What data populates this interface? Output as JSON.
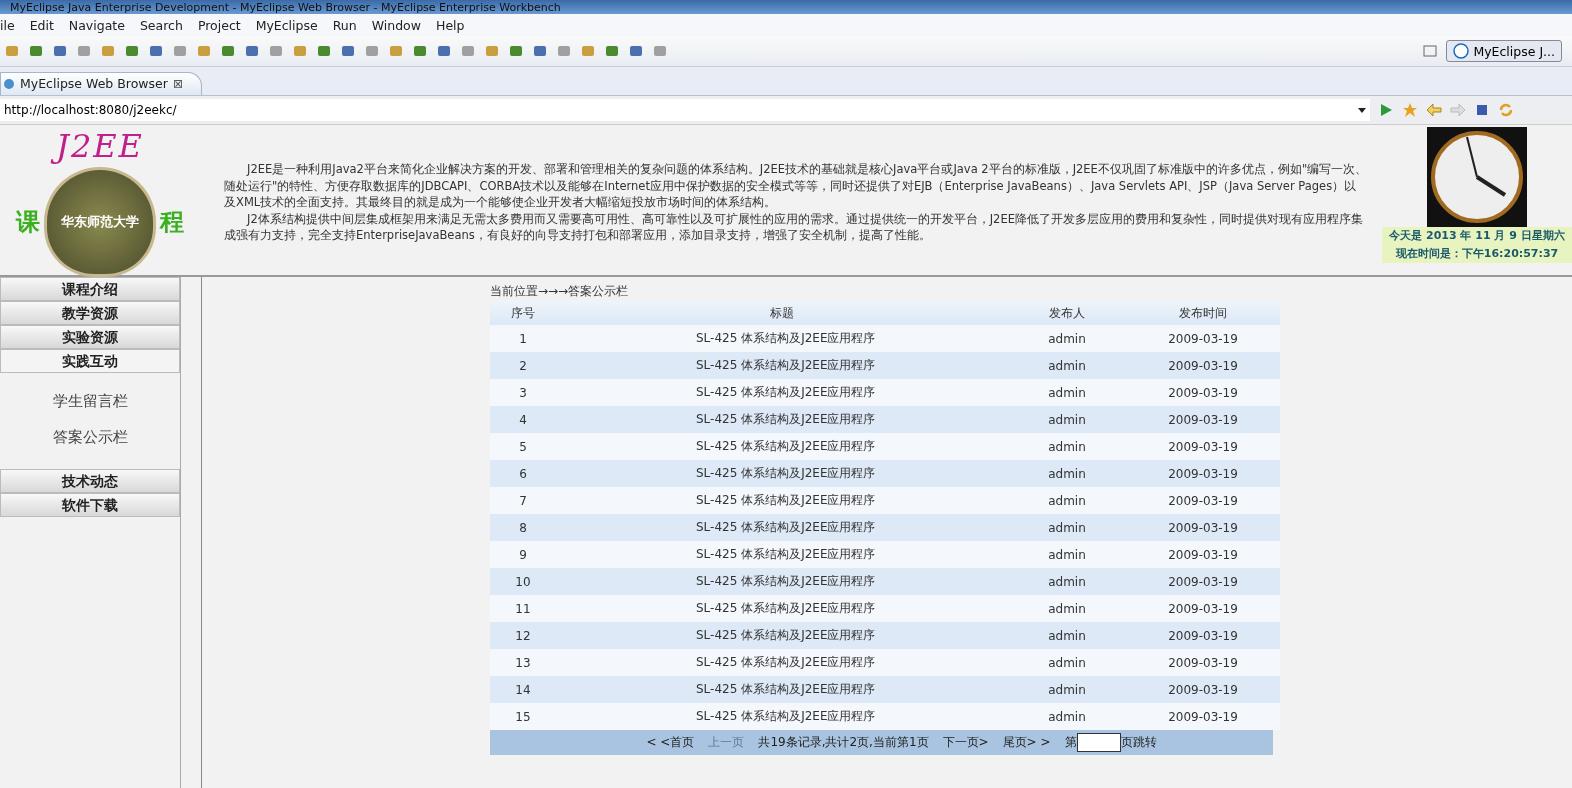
{
  "window": {
    "title": "MyEclipse Java Enterprise Development - MyEclipse Web Browser - MyEclipse Enterprise Workbench"
  },
  "menu": [
    "ile",
    "Edit",
    "Navigate",
    "Search",
    "Project",
    "MyEclipse",
    "Run",
    "Window",
    "Help"
  ],
  "perspective": {
    "label": "MyEclipse J..."
  },
  "editor_tab": {
    "label": "MyEclipse Web Browser",
    "close": "⊠"
  },
  "browser": {
    "url": "http://localhost:8080/j2eekc/"
  },
  "header": {
    "logo_title": "J2EE",
    "logo_left": "课",
    "logo_right": "程",
    "emblem_text": "华东师范大学",
    "paragraphs": [
      "J2EE是一种利用Java2平台来简化企业解决方案的开发、部署和管理相关的复杂问题的体系结构。J2EE技术的基础就是核心Java平台或Java 2平台的标准版，J2EE不仅巩固了标准版中的许多优点，例如\"编写一次、随处运行\"的特性、方便存取数据库的JDBCAPI、CORBA技术以及能够在Internet应用中保护数据的安全模式等等，同时还提供了对EJB（Enterprise JavaBeans）、Java Servlets API、JSP（Java Server Pages）以及XML技术的全面支持。其最终目的就是成为一个能够使企业开发者大幅缩短投放市场时间的体系结构。",
      "J2体系结构提供中间层集成框架用来满足无需太多费用而又需要高可用性、高可靠性以及可扩展性的应用的需求。通过提供统一的开发平台，J2EE降低了开发多层应用的费用和复杂性，同时提供对现有应用程序集成强有力支持，完全支持EnterpriseJavaBeans，有良好的向导支持打包和部署应用，添加目录支持，增强了安全机制，提高了性能。"
    ],
    "date": "今天是 2013 年 11 月 9 日星期六",
    "time": "现在时间是：下午16:20:57:37"
  },
  "sidebar": {
    "items": [
      {
        "label": "课程介绍",
        "expanded": false
      },
      {
        "label": "教学资源",
        "expanded": false
      },
      {
        "label": "实验资源",
        "expanded": false
      },
      {
        "label": "实践互动",
        "expanded": true,
        "children": [
          {
            "label": "学生留言栏"
          },
          {
            "label": "答案公示栏"
          }
        ]
      },
      {
        "label": "技术动态",
        "expanded": false
      },
      {
        "label": "软件下载",
        "expanded": false
      }
    ]
  },
  "breadcrumb": "当前位置→→→答案公示栏",
  "table": {
    "columns": [
      "序号",
      "标题",
      "发布人",
      "发布时间"
    ],
    "rows": [
      [
        "1",
        "SL-425 体系结构及J2EE应用程序",
        "admin",
        "2009-03-19"
      ],
      [
        "2",
        "SL-425 体系结构及J2EE应用程序",
        "admin",
        "2009-03-19"
      ],
      [
        "3",
        "SL-425 体系结构及J2EE应用程序",
        "admin",
        "2009-03-19"
      ],
      [
        "4",
        "SL-425 体系结构及J2EE应用程序",
        "admin",
        "2009-03-19"
      ],
      [
        "5",
        "SL-425 体系结构及J2EE应用程序",
        "admin",
        "2009-03-19"
      ],
      [
        "6",
        "SL-425 体系结构及J2EE应用程序",
        "admin",
        "2009-03-19"
      ],
      [
        "7",
        "SL-425 体系结构及J2EE应用程序",
        "admin",
        "2009-03-19"
      ],
      [
        "8",
        "SL-425 体系结构及J2EE应用程序",
        "admin",
        "2009-03-19"
      ],
      [
        "9",
        "SL-425 体系结构及J2EE应用程序",
        "admin",
        "2009-03-19"
      ],
      [
        "10",
        "SL-425 体系结构及J2EE应用程序",
        "admin",
        "2009-03-19"
      ],
      [
        "11",
        "SL-425 体系结构及J2EE应用程序",
        "admin",
        "2009-03-19"
      ],
      [
        "12",
        "SL-425 体系结构及J2EE应用程序",
        "admin",
        "2009-03-19"
      ],
      [
        "13",
        "SL-425 体系结构及J2EE应用程序",
        "admin",
        "2009-03-19"
      ],
      [
        "14",
        "SL-425 体系结构及J2EE应用程序",
        "admin",
        "2009-03-19"
      ],
      [
        "15",
        "SL-425 体系结构及J2EE应用程序",
        "admin",
        "2009-03-19"
      ]
    ]
  },
  "pager": {
    "links": [
      {
        "label": "< <首页",
        "disabled": false
      },
      {
        "label": "上一页",
        "disabled": true
      }
    ],
    "summary": "共19条记录,共计2页,当前第1页",
    "links_after": [
      {
        "label": "下一页>",
        "disabled": false
      },
      {
        "label": "尾页> >",
        "disabled": false
      }
    ],
    "goto_before": "第",
    "goto_after": "页跳转"
  }
}
